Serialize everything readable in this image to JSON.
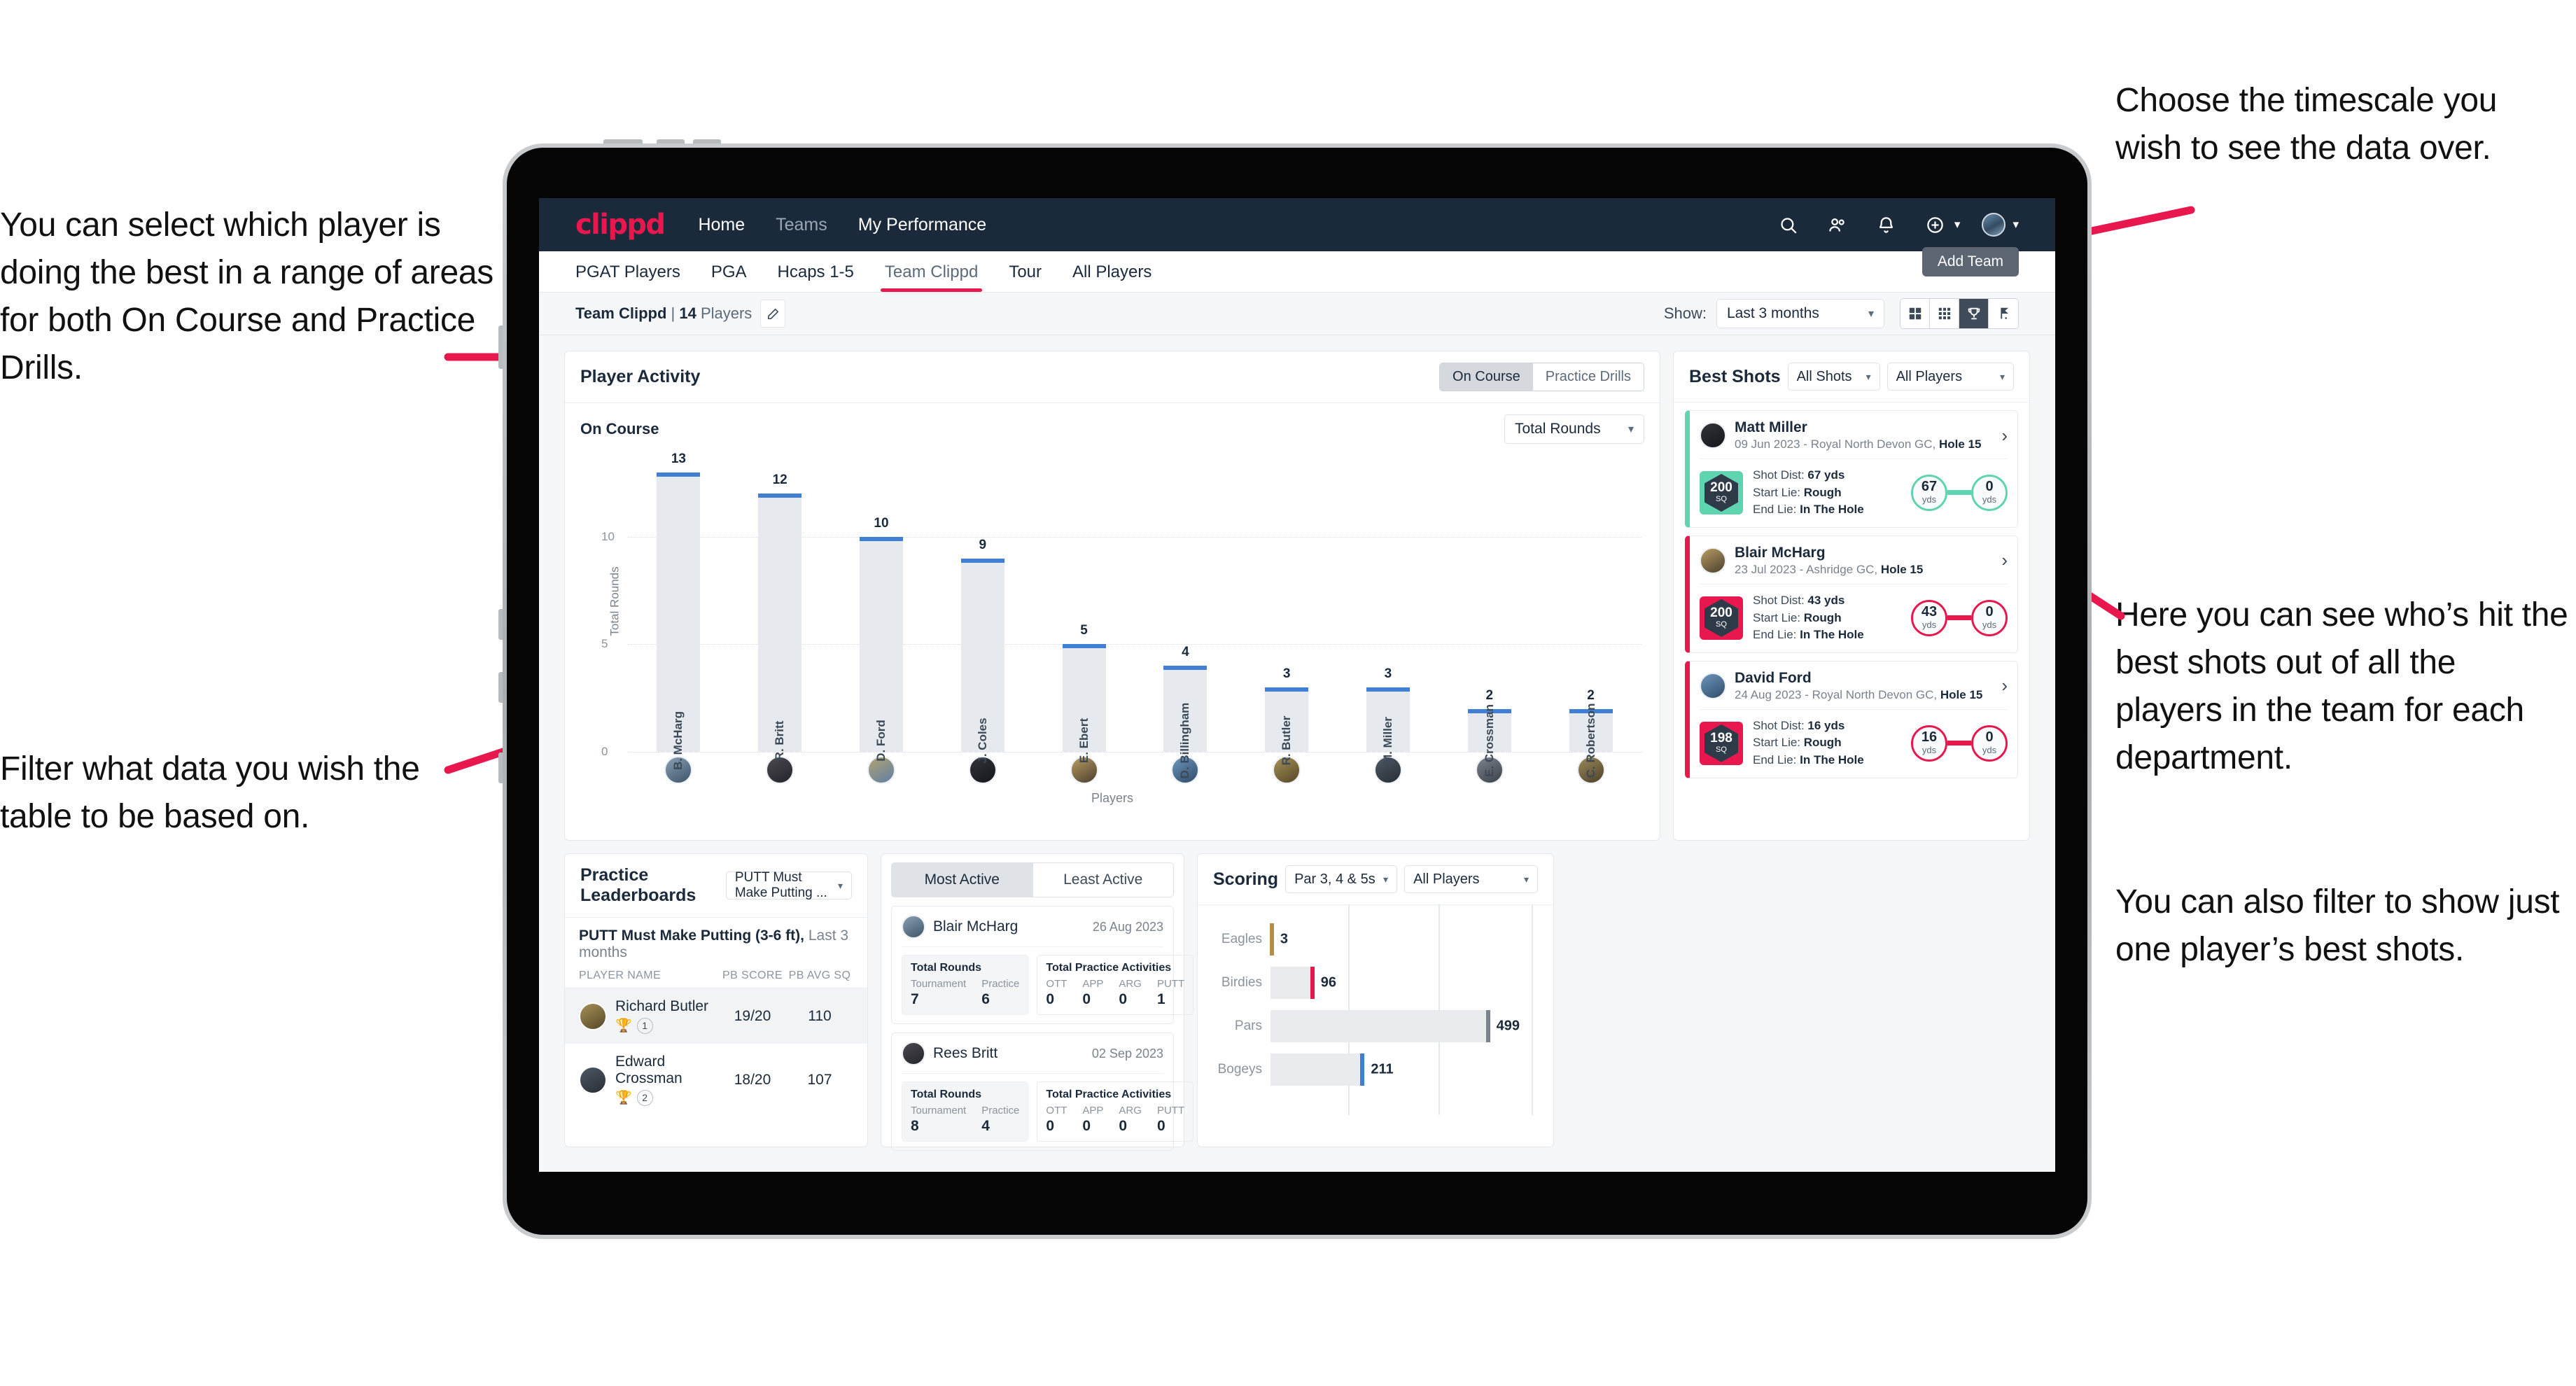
{
  "annotations": {
    "left_top": "You can select which player is doing the best in a range of areas for both On Course and Practice Drills.",
    "left_bottom": "Filter what data you wish the table to be based on.",
    "right_top": "Choose the timescale you wish to see the data over.",
    "right_middle": "Here you can see who’s hit the best shots out of all the players in the team for each department.",
    "right_bottom": "You can also filter to show just one player’s best shots."
  },
  "topnav": {
    "brand": "clippd",
    "links": [
      {
        "label": "Home",
        "dim": false
      },
      {
        "label": "Teams",
        "dim": true
      },
      {
        "label": "My Performance",
        "dim": false
      }
    ],
    "icons": [
      "search-icon",
      "people-icon",
      "bell-icon",
      "plus-circle-icon",
      "avatar-icon"
    ]
  },
  "tabs": {
    "items": [
      {
        "label": "PGAT Players",
        "active": false
      },
      {
        "label": "PGA",
        "active": false
      },
      {
        "label": "Hcaps 1-5",
        "active": false
      },
      {
        "label": "Team Clippd",
        "active": true
      },
      {
        "label": "Tour",
        "active": false
      },
      {
        "label": "All Players",
        "active": false
      }
    ],
    "add_team": "Add Team"
  },
  "subbar": {
    "team_name": "Team Clippd",
    "separator": " | ",
    "player_count": "14",
    "players_word": " Players",
    "show_label": "Show:",
    "timescale": "Last 3 months",
    "view_toggle": [
      {
        "icon": "grid-large-icon",
        "active": false
      },
      {
        "icon": "grid-small-icon",
        "active": false
      },
      {
        "icon": "trophy-icon",
        "active": true
      },
      {
        "icon": "golf-flag-icon",
        "active": false
      }
    ]
  },
  "activity": {
    "title": "Player Activity",
    "segments": [
      {
        "label": "On Course",
        "active": true
      },
      {
        "label": "Practice Drills",
        "active": false
      }
    ],
    "sub_title": "On Course",
    "metric_select": "Total Rounds"
  },
  "chart_data": [
    {
      "type": "bar",
      "title": "Player Activity - On Course",
      "xlabel": "Players",
      "ylabel": "Total Rounds",
      "ylim": [
        0,
        14
      ],
      "yticks": [
        0,
        5,
        10
      ],
      "grid": true,
      "categories": [
        "B. McHarg",
        "R. Britt",
        "D. Ford",
        "J. Coles",
        "E. Ebert",
        "D. Billingham",
        "R. Butler",
        "M. Miller",
        "E. Crossman",
        "C. Robertson"
      ],
      "values": [
        13,
        12,
        10,
        9,
        5,
        4,
        3,
        3,
        2,
        2
      ],
      "bar_color": "#e6e9ed",
      "cap_color": "#3f7fd4"
    },
    {
      "type": "bar",
      "orientation": "horizontal",
      "title": "Scoring",
      "categories": [
        "Eagles",
        "Birdies",
        "Pars",
        "Bogeys"
      ],
      "values": [
        3,
        96,
        499,
        211
      ],
      "cap_colors": [
        "#b38f4a",
        "#e8174e",
        "#7a838d",
        "#3f7fd4"
      ],
      "xlim": [
        0,
        620
      ],
      "grid": true
    }
  ],
  "best_shots": {
    "title": "Best Shots",
    "shot_filter": "All Shots",
    "player_filter": "All Players",
    "cards": [
      {
        "player": "Matt Miller",
        "meta_date": "09 Jun 2023",
        "meta_course": " - Royal North Devon GC, ",
        "meta_hole": "Hole 15",
        "sq": "200",
        "sq_unit": "SQ",
        "shot_dist_label": "Shot Dist: ",
        "shot_dist": "67 yds",
        "start_lie_label": "Start Lie: ",
        "start_lie": "Rough",
        "end_lie_label": "End Lie: ",
        "end_lie": "In The Hole",
        "from": "67",
        "from_unit": "yds",
        "to": "0",
        "to_unit": "yds",
        "accent": "#5fd4b0"
      },
      {
        "player": "Blair McHarg",
        "meta_date": "23 Jul 2023",
        "meta_course": " - Ashridge GC, ",
        "meta_hole": "Hole 15",
        "sq": "200",
        "sq_unit": "SQ",
        "shot_dist_label": "Shot Dist: ",
        "shot_dist": "43 yds",
        "start_lie_label": "Start Lie: ",
        "start_lie": "Rough",
        "end_lie_label": "End Lie: ",
        "end_lie": "In The Hole",
        "from": "43",
        "from_unit": "yds",
        "to": "0",
        "to_unit": "yds",
        "accent": "#e8174e"
      },
      {
        "player": "David Ford",
        "meta_date": "24 Aug 2023",
        "meta_course": " - Royal North Devon GC, ",
        "meta_hole": "Hole 15",
        "sq": "198",
        "sq_unit": "SQ",
        "shot_dist_label": "Shot Dist: ",
        "shot_dist": "16 yds",
        "start_lie_label": "Start Lie: ",
        "start_lie": "Rough",
        "end_lie_label": "End Lie: ",
        "end_lie": "In The Hole",
        "from": "16",
        "from_unit": "yds",
        "to": "0",
        "to_unit": "yds",
        "accent": "#e8174e"
      }
    ]
  },
  "leaderboard": {
    "title": "Practice Leaderboards",
    "drill_select": "PUTT Must Make Putting ...",
    "subtitle_bold": "PUTT Must Make Putting (3-6 ft),",
    "subtitle_rest": " Last 3 months",
    "columns": [
      "PLAYER NAME",
      "PB SCORE",
      "PB AVG SQ"
    ],
    "rows": [
      {
        "name": "Richard Butler",
        "rank": "1",
        "trophy": "gold",
        "pb_score": "19/20",
        "pb_avg_sq": "110",
        "highlight": true
      },
      {
        "name": "Edward Crossman",
        "rank": "2",
        "trophy": "silver",
        "pb_score": "18/20",
        "pb_avg_sq": "107",
        "highlight": false
      }
    ]
  },
  "activity_feed": {
    "tabs": [
      {
        "label": "Most Active",
        "active": true
      },
      {
        "label": "Least Active",
        "active": false
      }
    ],
    "rounds_title": "Total Rounds",
    "practice_title": "Total Practice Activities",
    "rounds_cols": [
      "Tournament",
      "Practice"
    ],
    "practice_cols": [
      "OTT",
      "APP",
      "ARG",
      "PUTT"
    ],
    "cards": [
      {
        "player": "Blair McHarg",
        "date": "26 Aug 2023",
        "rounds": [
          "7",
          "6"
        ],
        "practice": [
          "0",
          "0",
          "0",
          "1"
        ]
      },
      {
        "player": "Rees Britt",
        "date": "02 Sep 2023",
        "rounds": [
          "8",
          "4"
        ],
        "practice": [
          "0",
          "0",
          "0",
          "0"
        ]
      }
    ]
  },
  "scoring": {
    "title": "Scoring",
    "type_filter": "Par 3, 4 & 5s",
    "player_filter": "All Players"
  }
}
